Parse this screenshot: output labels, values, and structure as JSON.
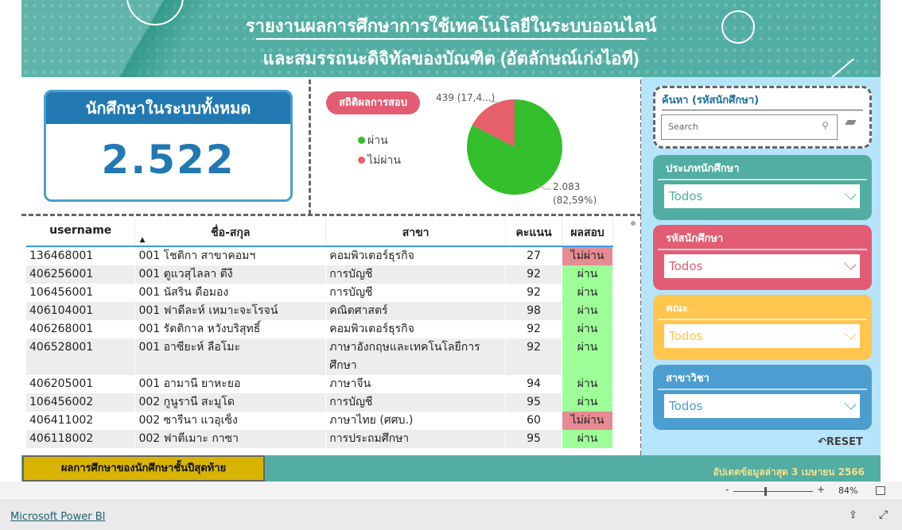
{
  "header": {
    "title_line1": "รายงานผลการศึกษาการใช้เทคโนโลยีในระบบออนไลน์",
    "title_line2": "และสมรรถนะดิจิทัลของบัณฑิต (อัตลักษณ์เก่งไอที)"
  },
  "kpi": {
    "label": "นักศึกษาในระบบทั้งหมด",
    "value": "2.522"
  },
  "stats": {
    "badge": "สถิติผลการสอบ",
    "legend": [
      {
        "label": "ผ่าน",
        "color": "#33BE2B"
      },
      {
        "label": "ไม่ผ่าน",
        "color": "#E5606A"
      }
    ],
    "chart_data": {
      "type": "pie",
      "slices": [
        {
          "label": "ผ่าน",
          "value": 2083,
          "percent": 82.59,
          "color": "#33BE2B"
        },
        {
          "label": "ไม่ผ่าน",
          "value": 439,
          "percent": 17.41,
          "color": "#E5606A"
        }
      ],
      "data_labels": {
        "fail": "439 (17,4...)",
        "pass_value": "2.083",
        "pass_percent": "(82,59%)"
      },
      "legend_placement": "left"
    }
  },
  "table": {
    "columns": [
      "username",
      "ชื่อ-สกุล",
      "สาขา",
      "คะแนน",
      "ผลสอบ"
    ],
    "rows": [
      [
        "136468001",
        "001 โชติกา สาขาคอมฯ",
        "คอมพิวเตอร์ธุรกิจ",
        "27",
        "ไม่ผ่าน"
      ],
      [
        "406256001",
        "001 ตูแวสุไลลา ตีงี",
        "การบัญชี",
        "92",
        "ผ่าน"
      ],
      [
        "106456001",
        "001 นัสริน ดือมอง",
        "การบัญชี",
        "92",
        "ผ่าน"
      ],
      [
        "406104001",
        "001 ฟาดีละห์ เหมาะจะโรจน์",
        "คณิตศาสตร์",
        "98",
        "ผ่าน"
      ],
      [
        "406268001",
        "001 รัตติกาล หวังบริสุทธิ์",
        "คอมพิวเตอร์ธุรกิจ",
        "92",
        "ผ่าน"
      ],
      [
        "406528001",
        "001 อาซียะห์ ลือโมะ",
        "ภาษาอังกฤษและเทคโนโลยีการศึกษา",
        "92",
        "ผ่าน"
      ],
      [
        "406205001",
        "001 อามานี ยาหะยอ",
        "ภาษาจีน",
        "94",
        "ผ่าน"
      ],
      [
        "106456002",
        "002 กูนูรานี สะมูโด",
        "การบัญชี",
        "95",
        "ผ่าน"
      ],
      [
        "406411002",
        "002 ซารีนา แวอุเซ็ง",
        "ภาษาไทย (ศศบ.)",
        "60",
        "ไม่ผ่าน"
      ],
      [
        "406118002",
        "002 ฟาตีเมาะ กาซา",
        "การประถมศึกษา",
        "95",
        "ผ่าน"
      ]
    ]
  },
  "sidebar": {
    "search_label": "ค้นหา (รหัสนักศึกษา)",
    "search_placeholder": "Search",
    "slicers": [
      {
        "label": "ประเภทนักศึกษา",
        "value": "Todos",
        "color": "#52AEA2"
      },
      {
        "label": "รหัสนักศึกษา",
        "value": "Todos",
        "color": "#E25C73"
      },
      {
        "label": "คณะ",
        "value": "Todos",
        "color": "#FFC54D"
      },
      {
        "label": "สาขาวิชา",
        "value": "Todos",
        "color": "#4C9ED0"
      }
    ],
    "reset": "RESET"
  },
  "footer": {
    "button": "ผลการศึกษาของนักศึกษาชั้นปีสุดท้าย",
    "updated": "อัปเดตข้อมูลล่าสุด 3 เมษายน 2566"
  },
  "zoom": {
    "level": "84%",
    "minus": "-",
    "plus": "+"
  },
  "bottom": {
    "link": "Microsoft Power BI"
  }
}
